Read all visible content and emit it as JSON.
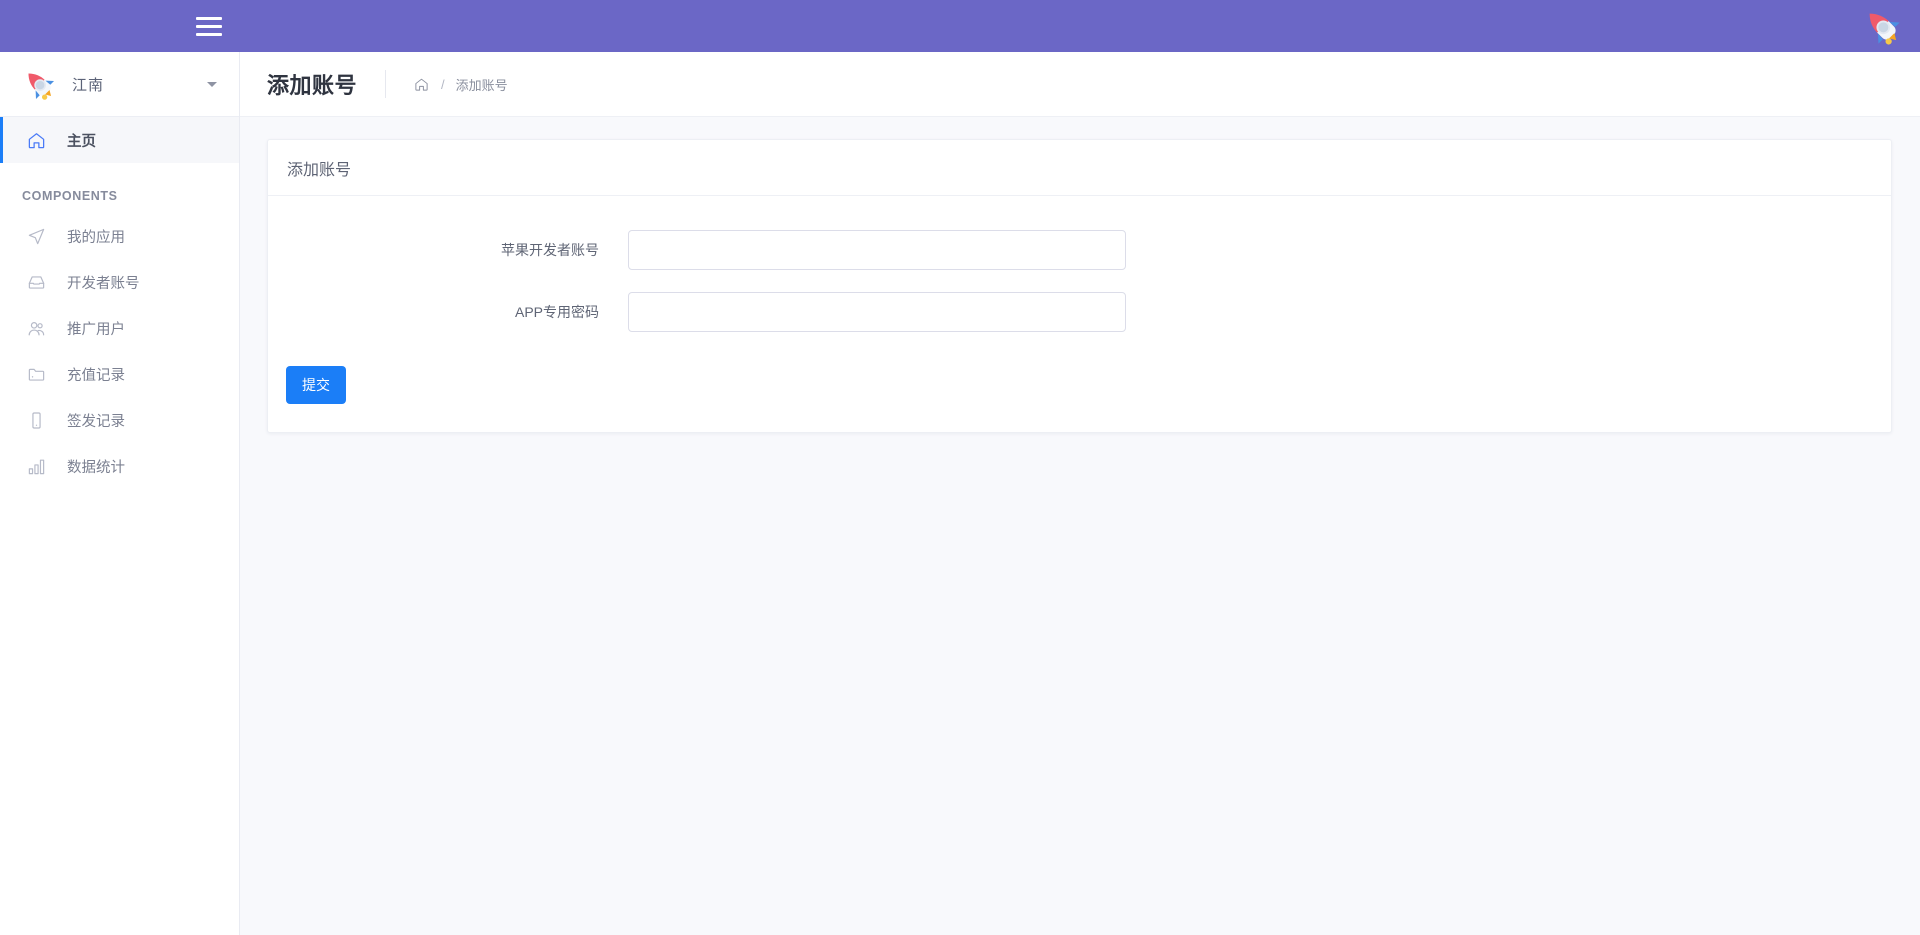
{
  "topbar": {
    "menu_toggle_name": "hamburger-menu",
    "logo_alt": "rocket-logo",
    "background_color": "#6b67c6"
  },
  "sidebar": {
    "brand": {
      "name": "江南",
      "logo_alt": "rocket-logo",
      "caret": "▾"
    },
    "primary": [
      {
        "label": "主页",
        "icon": "home-icon",
        "active": true
      }
    ],
    "section_label": "COMPONENTS",
    "items": [
      {
        "label": "我的应用",
        "icon": "send-icon"
      },
      {
        "label": "开发者账号",
        "icon": "inbox-icon"
      },
      {
        "label": "推广用户",
        "icon": "users-icon"
      },
      {
        "label": "充值记录",
        "icon": "folder-icon"
      },
      {
        "label": "签发记录",
        "icon": "tablet-icon"
      },
      {
        "label": "数据统计",
        "icon": "bar-chart-icon"
      }
    ],
    "accent_color": "#1b7ef7"
  },
  "page": {
    "title": "添加账号",
    "breadcrumb": {
      "home_icon": "home-icon",
      "separator": "/",
      "current": "添加账号"
    }
  },
  "card": {
    "header": "添加账号",
    "form": {
      "fields": [
        {
          "label": "苹果开发者账号",
          "value": "",
          "placeholder": "",
          "name": "apple-developer-account-input"
        },
        {
          "label": "APP专用密码",
          "value": "",
          "placeholder": "",
          "name": "app-specific-password-input"
        }
      ],
      "submit_label": "提交",
      "submit_color": "#1b7ef7"
    }
  }
}
